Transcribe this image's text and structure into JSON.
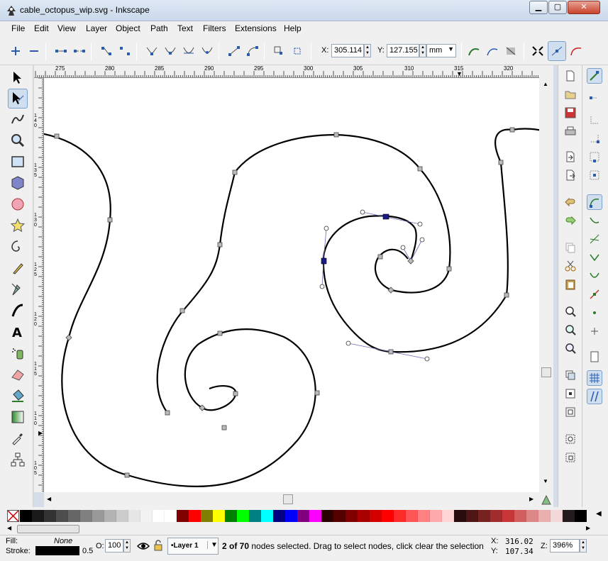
{
  "window": {
    "title": "cable_octopus_wip.svg - Inkscape",
    "min": "▁",
    "max": "▢",
    "close": "✕"
  },
  "menu": [
    "File",
    "Edit",
    "View",
    "Layer",
    "Object",
    "Path",
    "Text",
    "Filters",
    "Extensions",
    "Help"
  ],
  "controls": {
    "x_label": "X:",
    "x_value": "305.114",
    "y_label": "Y:",
    "y_value": "127.155",
    "unit": "mm"
  },
  "ruler": {
    "h_ticks": [
      "275",
      "280",
      "285",
      "290",
      "295",
      "300",
      "305",
      "310",
      "315",
      "320"
    ],
    "v_ticks": [
      "140",
      "135",
      "130",
      "125",
      "120",
      "115",
      "110",
      "105"
    ]
  },
  "palette": {
    "colors": [
      "#000000",
      "#1a1a1a",
      "#333333",
      "#4d4d4d",
      "#666666",
      "#808080",
      "#999999",
      "#b3b3b3",
      "#cccccc",
      "#e6e6e6",
      "#f2f2f2",
      "#ffffff",
      "#ffffff",
      "#800000",
      "#ff0000",
      "#808000",
      "#ffff00",
      "#008000",
      "#00ff00",
      "#008080",
      "#00ffff",
      "#000080",
      "#0000ff",
      "#800080",
      "#ff00ff",
      "#2b0000",
      "#550000",
      "#800000",
      "#aa0000",
      "#d40000",
      "#ff0000",
      "#ff2a2a",
      "#ff5555",
      "#ff8080",
      "#ffaaaa",
      "#ffd5d5",
      "#280b0b",
      "#501616",
      "#782121",
      "#a02c2c",
      "#c83737",
      "#d35f5f",
      "#de8787",
      "#e9afaf",
      "#f4d7d7",
      "#241c1c",
      "#000000"
    ]
  },
  "status": {
    "fill_label": "Fill:",
    "fill_value": "None",
    "stroke_label": "Stroke:",
    "stroke_width": "0.5",
    "opacity_label": "O:",
    "opacity_value": "100",
    "layer": "•Layer 1",
    "message_bold": "2 of 70",
    "message": " nodes selected. Drag to select nodes, click clear the selection",
    "x_label": "X:",
    "x_value": "316.02",
    "y_label": "Y:",
    "y_value": "107.34",
    "zoom_label": "Z:",
    "zoom_value": "396%"
  }
}
